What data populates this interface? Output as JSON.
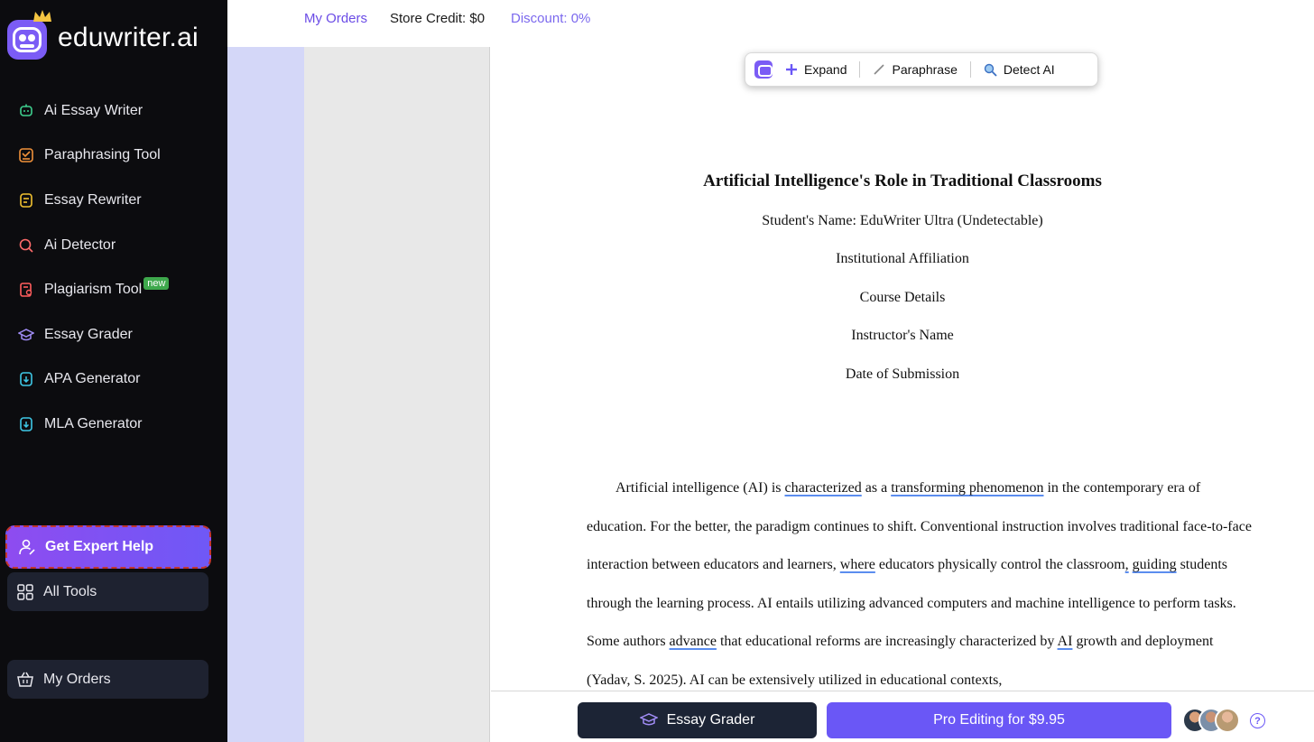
{
  "brand": {
    "name": "eduwriter.ai",
    "accent": "#7b5cf5"
  },
  "sidebar": {
    "items": [
      {
        "label": "Ai Essay Writer",
        "icon": "robot-icon",
        "color": "#3ecf8e"
      },
      {
        "label": "Paraphrasing Tool",
        "icon": "paraphrase-icon",
        "color": "#f0913a"
      },
      {
        "label": "Essay Rewriter",
        "icon": "rewrite-icon",
        "color": "#f2c230"
      },
      {
        "label": "Ai Detector",
        "icon": "search-icon",
        "color": "#ff6b6b"
      },
      {
        "label": "Plagiarism Tool",
        "icon": "plagiarism-icon",
        "color": "#ff5d5d",
        "badge": "new"
      },
      {
        "label": "Essay Grader",
        "icon": "graduation-cap-icon",
        "color": "#a08cf5"
      },
      {
        "label": "APA Generator",
        "icon": "citation-icon",
        "color": "#3ec8e6"
      },
      {
        "label": "MLA Generator",
        "icon": "citation-icon",
        "color": "#3ec8e6"
      }
    ],
    "expert_help": "Get Expert Help",
    "all_tools": "All Tools",
    "my_orders": "My Orders"
  },
  "topbar": {
    "my_orders": "My Orders",
    "store_credit": "Store Credit: $0",
    "discount": "Discount: 0%"
  },
  "toolbar": {
    "expand": "Expand",
    "paraphrase": "Paraphrase",
    "detect_ai": "Detect AI"
  },
  "document": {
    "title": "Artificial Intelligence's Role in Traditional Classrooms",
    "student_name": "Student's Name: EduWriter Ultra (Undetectable)",
    "affiliation": "Institutional Affiliation",
    "course": "Course Details",
    "instructor": "Instructor's Name",
    "date": "Date of Submission",
    "paragraph": [
      {
        "t": "Artificial intelligence (AI) is "
      },
      {
        "t": "characterized",
        "u": true
      },
      {
        "t": " as a "
      },
      {
        "t": "transforming phenomenon",
        "u": true
      },
      {
        "t": " in the contemporary era of education. For the better, the paradigm continues to shift. Conventional instruction involves traditional face-to-face interaction between educators and learners, "
      },
      {
        "t": "where",
        "u": true
      },
      {
        "t": " educators physically control the classroom"
      },
      {
        "t": ",",
        "u": true
      },
      {
        "t": " "
      },
      {
        "t": "guiding",
        "u": true
      },
      {
        "t": " students through the learning process. AI entails utilizing advanced computers and machine intelligence to perform tasks. Some authors "
      },
      {
        "t": "advance",
        "u": true
      },
      {
        "t": " that educational reforms are increasingly characterized by "
      },
      {
        "t": "AI",
        "u": true
      },
      {
        "t": " growth and deployment (Yadav, S. 2025). AI can be extensively utilized in educational contexts,"
      }
    ]
  },
  "bottombar": {
    "essay_grader": "Essay Grader",
    "pro_editing": "Pro Editing for $9.95",
    "help": "?"
  }
}
